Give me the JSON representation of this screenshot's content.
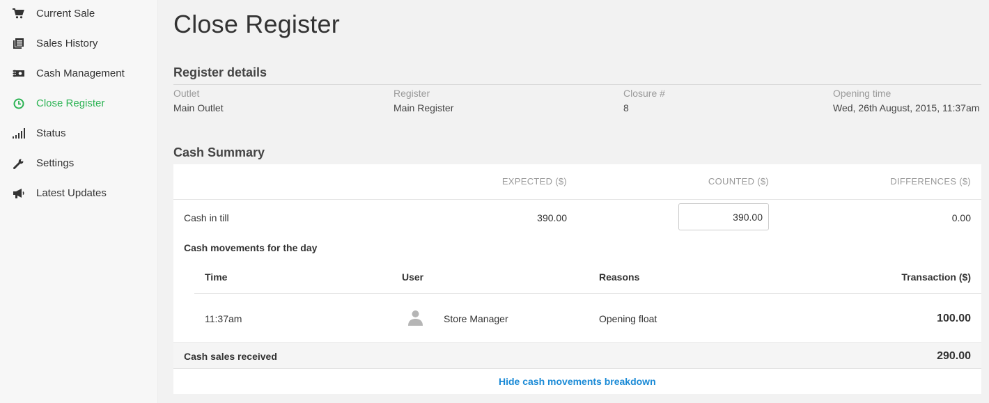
{
  "sidebar": {
    "items": [
      {
        "label": "Current Sale",
        "icon": "cart-icon"
      },
      {
        "label": "Sales History",
        "icon": "list-icon"
      },
      {
        "label": "Cash Management",
        "icon": "cash-icon"
      },
      {
        "label": "Close Register",
        "icon": "clock-icon",
        "active": true
      },
      {
        "label": "Status",
        "icon": "signal-icon"
      },
      {
        "label": "Settings",
        "icon": "wrench-icon"
      },
      {
        "label": "Latest Updates",
        "icon": "megaphone-icon"
      }
    ],
    "active_color": "#2bb353"
  },
  "page": {
    "title": "Close Register"
  },
  "register_details": {
    "title": "Register details",
    "outlet_label": "Outlet",
    "outlet_value": "Main Outlet",
    "register_label": "Register",
    "register_value": "Main Register",
    "closure_label": "Closure #",
    "closure_value": "8",
    "opening_label": "Opening time",
    "opening_value": "Wed, 26th August, 2015, 11:37am"
  },
  "cash_summary": {
    "title": "Cash Summary",
    "col_expected": "EXPECTED ($)",
    "col_counted": "COUNTED ($)",
    "col_differences": "DIFFERENCES ($)",
    "cash_in_till_label": "Cash in till",
    "cash_in_till_expected": "390.00",
    "cash_in_till_counted": "390.00",
    "cash_in_till_difference": "0.00",
    "movements_title": "Cash movements for the day",
    "movements_headers": {
      "time": "Time",
      "user": "User",
      "reasons": "Reasons",
      "transaction": "Transaction ($)"
    },
    "movements": [
      {
        "time": "11:37am",
        "user": "Store Manager",
        "reason": "Opening float",
        "amount": "100.00"
      }
    ],
    "cash_sales_label": "Cash sales received",
    "cash_sales_value": "290.00",
    "toggle_link": "Hide cash movements breakdown",
    "link_color": "#1a8ad6"
  }
}
